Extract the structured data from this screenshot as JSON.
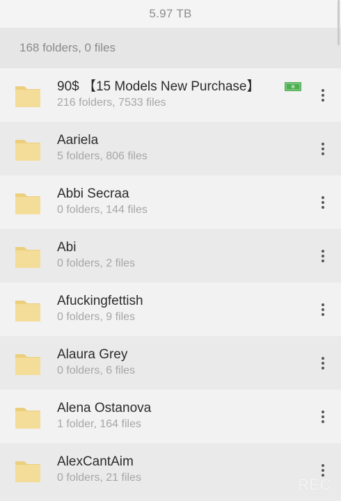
{
  "storage": {
    "total_size": "5.97 TB"
  },
  "summary": {
    "text": "168 folders, 0 files"
  },
  "folders": [
    {
      "name": "90$ 【15 Models New Purchase】",
      "meta": "216 folders, 7533 files",
      "badge_icon": "money-icon"
    },
    {
      "name": "Aariela",
      "meta": "5 folders, 806 files"
    },
    {
      "name": "Abbi Secraa",
      "meta": "0 folders, 144 files"
    },
    {
      "name": "Abi",
      "meta": "0 folders, 2 files"
    },
    {
      "name": "Afuckingfettish",
      "meta": "0 folders, 9 files"
    },
    {
      "name": "Alaura Grey",
      "meta": "0 folders, 6 files"
    },
    {
      "name": "Alena Ostanova",
      "meta": "1 folder, 164 files"
    },
    {
      "name": "AlexCantAim",
      "meta": "0 folders, 21 files"
    }
  ],
  "icons": {
    "folder": "folder-icon",
    "more": "more-vert-icon"
  },
  "colors": {
    "folder_fill": "#f3dd98",
    "folder_shade": "#ebcf7d",
    "money_green": "#4caf50"
  },
  "watermark": "REC"
}
